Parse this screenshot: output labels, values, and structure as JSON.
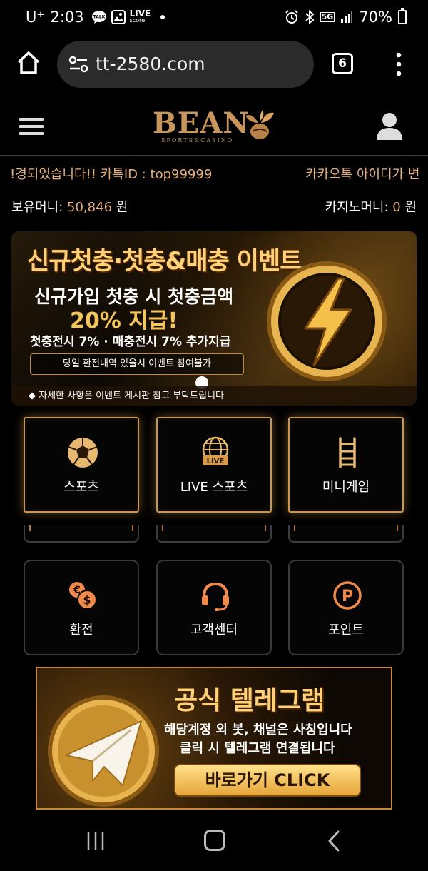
{
  "status_bar": {
    "carrier": "U⁺",
    "time": "2:03",
    "live_label": "LIVE",
    "score_label": "score",
    "talk_label": "TALK",
    "network": "5G",
    "battery": "70%"
  },
  "browser": {
    "url": "tt-2580.com",
    "tab_count": "6"
  },
  "site": {
    "logo_text": "BEAN",
    "logo_subtext": "SPORTS&CASINO"
  },
  "marquee": {
    "text": "!경되었습니다!! 카톡ID : top99999",
    "text2": "카카오톡 아이디가 변"
  },
  "money": {
    "holding_label": "보유머니:",
    "holding_value": "50,846",
    "holding_unit": "원",
    "casino_label": "카지노머니:",
    "casino_value": "0",
    "casino_unit": "원"
  },
  "event_banner": {
    "title": "신규첫충·첫충&매충 이벤트",
    "line1": "신규가입 첫충 시 첫충금액",
    "line2": "20% 지급!",
    "line3": "첫충전시 7% · 매충전시 7% 추가지급",
    "pill": "당일 환전내역 있을시 이벤트 참여불가",
    "footer": "◆ 자세한 사항은 이벤트 게시판 참고 부탁드립니다"
  },
  "game_tiles": [
    {
      "label": "스포츠",
      "icon": "soccer-ball-icon"
    },
    {
      "label": "LIVE 스포츠",
      "icon": "live-globe-icon",
      "badge": "LIVE"
    },
    {
      "label": "미니게임",
      "icon": "ladder-icon"
    }
  ],
  "service_tiles": [
    {
      "label": "환전",
      "icon": "currency-exchange-icon"
    },
    {
      "label": "고객센터",
      "icon": "headset-icon"
    },
    {
      "label": "포인트",
      "icon": "point-icon",
      "letter": "P"
    }
  ],
  "telegram_banner": {
    "title": "공식 텔레그램",
    "line1": "해당계정 외 봇, 채널은 사칭입니다",
    "line2": "클릭 시 텔레그램 연결됩니다",
    "button": "바로가기 CLICK"
  },
  "colors": {
    "gold": "#e6b07d",
    "tile_border": "#c99752",
    "icon_orange": "#f08a4b"
  }
}
